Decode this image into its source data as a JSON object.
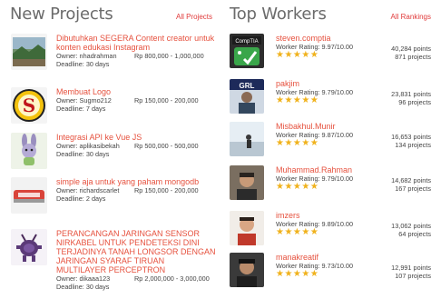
{
  "new_projects": {
    "title": "New Projects",
    "all_link": "All Projects",
    "items": [
      {
        "title": "Dibutuhkan SEGERA Content creator untuk konten edukasi Instagram",
        "owner": "Owner: nhadrahman",
        "budget": "Rp 800,000 - 1,000,000",
        "deadline": "Deadline: 30 days",
        "icon": "landscape-thumbnail"
      },
      {
        "title": "Membuat Logo",
        "owner": "Owner: Sugmo212",
        "budget": "Rp 150,000 - 200,000",
        "deadline": "Deadline: 7 days",
        "icon": "yellow-s-logo"
      },
      {
        "title": "Integrasi API ke Vue JS",
        "owner": "Owner: aplikasibekah",
        "budget": "Rp 500,000 - 500,000",
        "deadline": "Deadline: 30 days",
        "icon": "bunny-mascot"
      },
      {
        "title": "simple aja untuk yang paham mongodb",
        "owner": "Owner: richardscarlet",
        "budget": "Rp 150,000 - 200,000",
        "deadline": "Deadline: 2 days",
        "icon": "device-thumbnail"
      },
      {
        "title": "PERANCANGAN JARINGAN SENSOR NIRKABEL UNTUK PENDETEKSI DINI TERJADINYA TANAH LONGSOR DENGAN JARINGAN SYARAF TIRUAN MULTILAYER PERCEPTRON",
        "owner": "Owner: dikaaa123",
        "budget": "Rp 2,000,000 - 3,000,000",
        "deadline": "Deadline: 30 days",
        "icon": "purple-mascot"
      }
    ]
  },
  "top_workers": {
    "title": "Top Workers",
    "all_link": "All Rankings",
    "stars": "★★★★★",
    "items": [
      {
        "name": "steven.comptia",
        "rating": "Worker Rating: 9.97/10.00",
        "points": "40,284 points",
        "projects": "871 projects",
        "avatar": "comptia-tag"
      },
      {
        "name": "pakjim",
        "rating": "Worker Rating: 9.79/10.00",
        "points": "23,831 points",
        "projects": "96 projects",
        "avatar": "pakjim-photo"
      },
      {
        "name": "Misbakhul.Munir",
        "rating": "Worker Rating: 9.87/10.00",
        "points": "16,653 points",
        "projects": "134 projects",
        "avatar": "beach-photo"
      },
      {
        "name": "Muhammad.Rahman",
        "rating": "Worker Rating: 9.79/10.00",
        "points": "14,682 points",
        "projects": "167 projects",
        "avatar": "rahman-photo"
      },
      {
        "name": "imzers",
        "rating": "Worker Rating: 9.89/10.00",
        "points": "13,062 points",
        "projects": "64 projects",
        "avatar": "imzers-photo"
      },
      {
        "name": "manakreatif",
        "rating": "Worker Rating: 9.73/10.00",
        "points": "12,991 points",
        "projects": "107 projects",
        "avatar": "manakreatif-photo"
      }
    ]
  }
}
